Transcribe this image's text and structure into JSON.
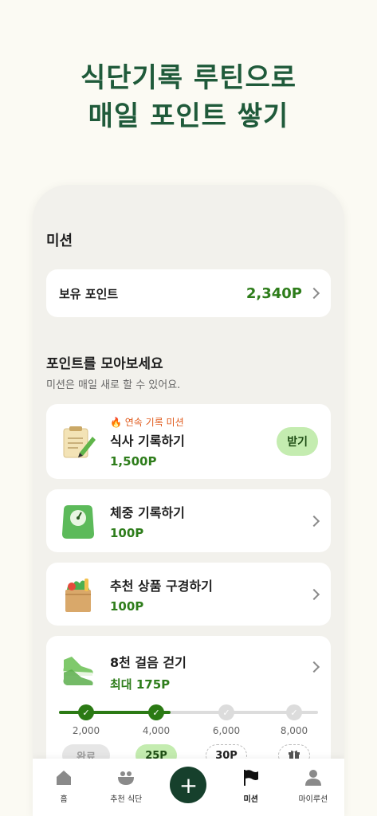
{
  "hero": {
    "line1": "식단기록 루틴으로",
    "line2": "매일 포인트 쌓기"
  },
  "screen": {
    "title": "미션"
  },
  "points": {
    "label": "보유 포인트",
    "value": "2,340P"
  },
  "section": {
    "title": "포인트를 모아보세요",
    "subtitle": "미션은 매일 새로 할 수 있어요."
  },
  "missions": [
    {
      "tag": "🔥 연속 기록 미션",
      "name": "식사 기록하기",
      "points": "1,500P",
      "action": "받기",
      "icon": "notepad-icon"
    },
    {
      "name": "체중 기록하기",
      "points": "100P",
      "icon": "scale-icon"
    },
    {
      "name": "추천 상품 구경하기",
      "points": "100P",
      "icon": "grocery-bag-icon"
    },
    {
      "name": "8천 걸음 걷기",
      "points": "최대 175P",
      "icon": "sneaker-icon"
    }
  ],
  "steps": {
    "progress_fraction": 0.43,
    "values": [
      "2,000",
      "4,000",
      "6,000",
      "8,000"
    ],
    "buttons": [
      "완료",
      "25P",
      "30P"
    ],
    "gift_icon": "gift-icon"
  },
  "tabs": [
    {
      "label": "홈",
      "icon": "home-icon"
    },
    {
      "label": "추천 식단",
      "icon": "bowl-icon"
    },
    {
      "label": "+",
      "icon": "plus-icon"
    },
    {
      "label": "미션",
      "icon": "flag-icon"
    },
    {
      "label": "마이루션",
      "icon": "person-icon"
    }
  ],
  "colors": {
    "brand_green": "#2e7d1b",
    "dark_green": "#16402c",
    "hero_green": "#1f5a3a",
    "accent_orange": "#e05a1c",
    "claim_bg": "#c4ecb0"
  }
}
